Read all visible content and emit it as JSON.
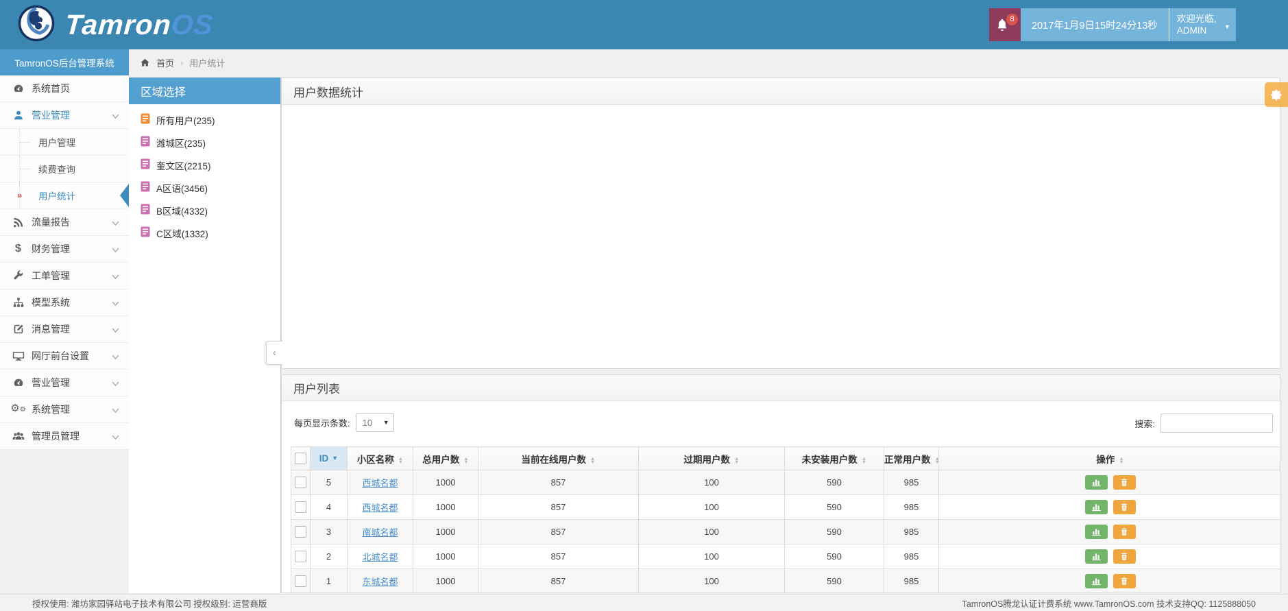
{
  "colors": {
    "header_blue": "#3c87b2",
    "subheader_blue": "#4e9ccb",
    "region_header_blue": "#539fd0",
    "accent_blue": "#3c8dbc",
    "bell_maroon": "#8e3a5a",
    "badge_red": "#d9534f",
    "light_blue_box": "#74b3da",
    "link_blue": "#4a90cb",
    "green_button": "#72b469",
    "orange_button": "#f0a63f",
    "active_arrow_red": "#d14b42"
  },
  "topbar": {
    "brand_primary": "Tamron",
    "brand_secondary": "OS",
    "notification_badge": "8",
    "datetime": "2017年1月9日15时24分13秒",
    "welcome_line1": "欢迎光临,",
    "welcome_line2": "ADMIN"
  },
  "sidebar": {
    "title": "TamronOS后台管理系统",
    "items": [
      {
        "type": "item",
        "label": "系统首页",
        "icon": "dashboard-icon",
        "chevron": false,
        "active": false
      },
      {
        "type": "item",
        "label": "营业管理",
        "icon": "user-icon",
        "chevron": true,
        "active": true
      },
      {
        "type": "sub",
        "label": "用户管理",
        "active": false
      },
      {
        "type": "sub",
        "label": "续费查询",
        "active": false
      },
      {
        "type": "sub",
        "label": "用户统计",
        "active": true
      },
      {
        "type": "item",
        "label": "流量报告",
        "icon": "rss-icon",
        "chevron": true,
        "active": false
      },
      {
        "type": "item",
        "label": "财务管理",
        "icon": "dollar-icon",
        "chevron": true,
        "active": false
      },
      {
        "type": "item",
        "label": "工单管理",
        "icon": "wrench-icon",
        "chevron": true,
        "active": false
      },
      {
        "type": "item",
        "label": "模型系统",
        "icon": "sitemap-icon",
        "chevron": true,
        "active": false
      },
      {
        "type": "item",
        "label": "消息管理",
        "icon": "edit-icon",
        "chevron": true,
        "active": false
      },
      {
        "type": "item",
        "label": "网厅前台设置",
        "icon": "monitor-icon",
        "chevron": true,
        "active": false
      },
      {
        "type": "item",
        "label": "营业管理",
        "icon": "gauge-icon",
        "chevron": true,
        "active": false
      },
      {
        "type": "item",
        "label": "系统管理",
        "icon": "gears-icon",
        "chevron": true,
        "active": false
      },
      {
        "type": "item",
        "label": "管理员管理",
        "icon": "users-icon",
        "chevron": true,
        "active": false
      }
    ]
  },
  "breadcrumb": {
    "home": "首页",
    "separator": "›",
    "current": "用户统计"
  },
  "region": {
    "title": "区域选择",
    "items": [
      {
        "label": "所有用户(235)",
        "color": "orange"
      },
      {
        "label": "潍城区(235)",
        "color": "pink"
      },
      {
        "label": "奎文区(2215)",
        "color": "pink"
      },
      {
        "label": "A区语(3456)",
        "color": "pink"
      },
      {
        "label": "B区域(4332)",
        "color": "pink"
      },
      {
        "label": "C区域(1332)",
        "color": "pink"
      }
    ]
  },
  "stats_panel": {
    "title": "用户数据统计"
  },
  "list_panel": {
    "title": "用户列表",
    "page_size_label": "每页显示条数:",
    "page_size_value": "10",
    "search_label": "搜索:",
    "search_value": ""
  },
  "table": {
    "columns": [
      {
        "label": "ID",
        "sorted": "desc"
      },
      {
        "label": "小区名称"
      },
      {
        "label": "总用户数"
      },
      {
        "label": "当前在线用户数"
      },
      {
        "label": "过期用户数"
      },
      {
        "label": "未安装用户数"
      },
      {
        "label": "正常用户数"
      },
      {
        "label": "操作"
      }
    ],
    "rows": [
      {
        "id": "5",
        "name": "西城名都",
        "total": "1000",
        "online": "857",
        "expired": "100",
        "uninstalled": "590",
        "normal": "985"
      },
      {
        "id": "4",
        "name": "西城名都",
        "total": "1000",
        "online": "857",
        "expired": "100",
        "uninstalled": "590",
        "normal": "985"
      },
      {
        "id": "3",
        "name": "南城名都",
        "total": "1000",
        "online": "857",
        "expired": "100",
        "uninstalled": "590",
        "normal": "985"
      },
      {
        "id": "2",
        "name": "北城名都",
        "total": "1000",
        "online": "857",
        "expired": "100",
        "uninstalled": "590",
        "normal": "985"
      },
      {
        "id": "1",
        "name": "东城名都",
        "total": "1000",
        "online": "857",
        "expired": "100",
        "uninstalled": "590",
        "normal": "985"
      }
    ]
  },
  "footer": {
    "left": "授权使用: 潍坊家园驿站电子技术有限公司  授权级别: 运营商版",
    "right": "TamronOS腾龙认证计费系统 www.TamronOS.com 技术支持QQ: 1125888050"
  }
}
